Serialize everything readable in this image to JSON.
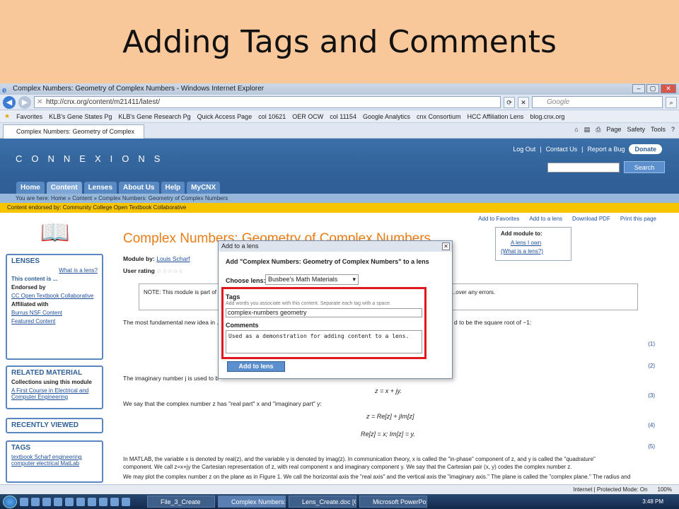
{
  "slide": {
    "title": "Adding Tags and Comments"
  },
  "window": {
    "title": "Complex Numbers: Geometry of Complex Numbers - Windows Internet Explorer"
  },
  "address": {
    "url": "http://cnx.org/content/m21411/latest/",
    "search_placeholder": "Google"
  },
  "favorites": [
    "Favorites",
    "KLB's Gene States Pg",
    "KLB's Gene Research Pg",
    "Quick Access Page",
    "col 10621",
    "OER OCW",
    "col 11154",
    "Google Analytics",
    "cnx Consortium",
    "HCC Affiliation Lens",
    "blog.cnx.org"
  ],
  "tab": {
    "label": "Complex Numbers: Geometry of Complex Numb..."
  },
  "tab_tools": [
    "Page",
    "Safety",
    "Tools"
  ],
  "cnx": {
    "logo": "CONNEXIONS",
    "links": [
      "Log Out",
      "Contact Us",
      "Report a Bug"
    ],
    "donate": "Donate",
    "search_btn": "Search",
    "nav": [
      "Home",
      "Content",
      "Lenses",
      "About Us",
      "Help",
      "MyCNX"
    ],
    "breadcrumb": "You are here: Home » Content » Complex Numbers: Geometry of Complex Numbers",
    "endorsed": "Content endorsed by: Community College Open Textbook Collaborative"
  },
  "sidebar": {
    "lenses_title": "LENSES",
    "what_lens": "What is a lens?",
    "this_content": "This content is ...",
    "endorsed_by": "Endorsed by",
    "endorser": "CC Open Textbook Collaborative",
    "affiliated": "Affiliated with",
    "aff1": "Burrus NSF Content",
    "aff2": "Featured Content",
    "related_title": "RELATED MATERIAL",
    "collections": "Collections using this module",
    "collection1": "A First Course in Electrical and Computer Engineering",
    "recent_title": "RECENTLY VIEWED",
    "tags_title": "TAGS",
    "tags_text": "textbook Scharf engineering computer electrical MatLab"
  },
  "actions": [
    "Add to Favorites",
    "Add to a lens",
    "Download PDF",
    "Print this page"
  ],
  "lenspop": {
    "title": "Add module to:",
    "own": "A lens I own",
    "what": "(What is a lens?)"
  },
  "module": {
    "title": "Complex Numbers: Geometry of Complex Numbers",
    "by_label": "Module by:",
    "author": "Louis Scharf",
    "rating_label": "User rating",
    "note": "NOTE: This module is part of ... recognition technology, and ...es for this collection were created using an optical character ...over any errors.",
    "p1": "The most fundamental new idea in ...",
    "p1_end": "d to be the square root of −1:",
    "p2": "The imaginary number j is used to b",
    "eq3": "z = x + jy.",
    "p3": "We say that the complex number z has \"real part\" x and \"imaginary part\" y:",
    "eq4": "z = Re[z] + jIm[z]",
    "eq5": "Re[z] = x;  Im[z] = y.",
    "p4": "In MATLAB, the variable x is denoted by real(z), and the variable y is denoted by imag(z). In communication theory, x is called the \"in-phase\" component of z, and y is called the \"quadrature\"",
    "p5": "component. We call z=x+jy the Cartesian representation of z, with real component x and imaginary component y. We say that the Cartesian pair (x, y) codes the complex number z.",
    "p6": "We may plot the complex number z on the plane as in Figure 1. We call the horizontal axis the \"real axis\" and the vertical axis the \"imaginary axis.\" The plane is called the \"complex plane.\" The radius and",
    "eqnums": [
      "(1)",
      "(2)",
      "(3)",
      "(4)",
      "(5)"
    ]
  },
  "dialog": {
    "head": "Add to a lens",
    "title": "Add \"Complex Numbers: Geometry of Complex Numbers\" to a lens",
    "choose_label": "Choose lens:",
    "lens_value": "Busbee's Math Materials",
    "tags_label": "Tags",
    "tags_hint": "Add words you associate with this content. Separate each tag with a space.",
    "tags_value": "complex-numbers geometry",
    "comments_label": "Comments",
    "comments_value": "Used as a demonstration for adding content to a lens.",
    "add_btn": "Add to lens"
  },
  "status": {
    "zone": "Internet | Protected Mode: On",
    "zoom": "100%"
  },
  "taskbar": {
    "tasks": [
      "File_3_Create",
      "Complex Numbers: ...",
      "Lens_Create.doc [C...",
      "Microsoft PowerPoi..."
    ],
    "clock": "3:48 PM"
  }
}
